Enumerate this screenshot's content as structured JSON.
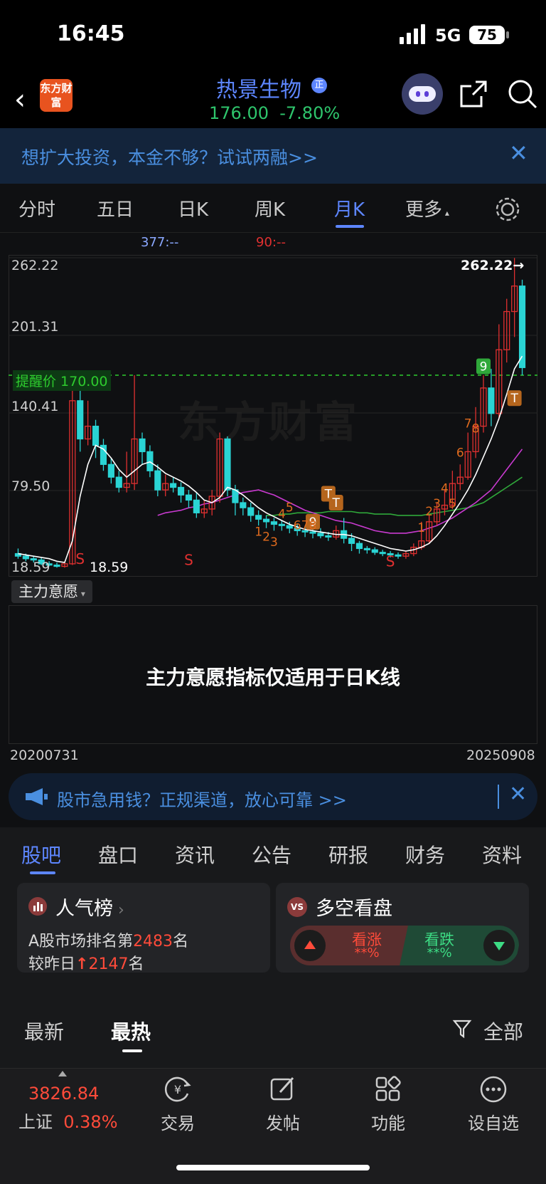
{
  "status_bar": {
    "time": "16:45",
    "network": "5G",
    "battery": "75"
  },
  "header": {
    "logo_text": "东方财富",
    "stock_name": "热景生物",
    "badge": "正",
    "price": "176.00",
    "change": "-7.80%"
  },
  "banner": {
    "text": "想扩大投资，本金不够？试试两融>>"
  },
  "period_tabs": [
    "分时",
    "五日",
    "日K",
    "周K",
    "月K",
    "更多"
  ],
  "ma_labels": {
    "ma377": "377:--",
    "ma90": "90:--"
  },
  "chart": {
    "y_labels": [
      "262.22",
      "201.31",
      "140.41",
      "79.50",
      "18.59"
    ],
    "high_label": "262.22→",
    "low_label": "18.59",
    "alert_label": "提醒价 170.00",
    "watermark": "东方财富",
    "signals": [
      "T",
      "T",
      "9",
      "T",
      "S",
      "S",
      "S"
    ],
    "seq_early": [
      "1",
      "2",
      "3",
      "4",
      "5",
      "6",
      "7",
      "8",
      "9"
    ],
    "seq_late": [
      "1",
      "2",
      "3",
      "4",
      "5",
      "6",
      "7",
      "8",
      "9"
    ],
    "colors": {
      "up": "#e03030",
      "down": "#2ad4d4",
      "ma_white": "#ffffff",
      "ma_magenta": "#c93ad0",
      "ma_green": "#2fa83a",
      "alert": "#2ecc2e"
    }
  },
  "chart_data": {
    "type": "candlestick",
    "title": "热景生物 月K",
    "y_range": [
      18.59,
      262.22
    ],
    "x_range": [
      "20200731",
      "20250908"
    ],
    "candles": [
      [
        30,
        28,
        34,
        26
      ],
      [
        28,
        26,
        30,
        24
      ],
      [
        26,
        25,
        28,
        23
      ],
      [
        25,
        22,
        27,
        21
      ],
      [
        22,
        21,
        24,
        20
      ],
      [
        21,
        20,
        23,
        19
      ],
      [
        20,
        22,
        24,
        19
      ],
      [
        22,
        150,
        170,
        21
      ],
      [
        150,
        120,
        168,
        110
      ],
      [
        120,
        130,
        150,
        115
      ],
      [
        130,
        115,
        135,
        105
      ],
      [
        115,
        100,
        120,
        95
      ],
      [
        100,
        90,
        105,
        85
      ],
      [
        90,
        82,
        95,
        78
      ],
      [
        82,
        85,
        110,
        78
      ],
      [
        85,
        120,
        170,
        80
      ],
      [
        120,
        110,
        125,
        100
      ],
      [
        110,
        95,
        115,
        90
      ],
      [
        95,
        80,
        100,
        75
      ],
      [
        80,
        85,
        92,
        75
      ],
      [
        85,
        82,
        90,
        78
      ],
      [
        82,
        76,
        86,
        70
      ],
      [
        76,
        72,
        80,
        66
      ],
      [
        72,
        62,
        78,
        58
      ],
      [
        62,
        65,
        72,
        58
      ],
      [
        65,
        75,
        80,
        60
      ],
      [
        75,
        120,
        125,
        70
      ],
      [
        120,
        80,
        122,
        75
      ],
      [
        80,
        70,
        84,
        60
      ],
      [
        70,
        66,
        74,
        60
      ],
      [
        66,
        60,
        70,
        55
      ],
      [
        60,
        57,
        64,
        52
      ],
      [
        57,
        55,
        60,
        50
      ],
      [
        55,
        53,
        58,
        48
      ],
      [
        53,
        52,
        56,
        48
      ],
      [
        52,
        50,
        55,
        46
      ],
      [
        50,
        48,
        53,
        44
      ],
      [
        48,
        47,
        52,
        43
      ],
      [
        47,
        46,
        50,
        42
      ],
      [
        46,
        44,
        50,
        42
      ],
      [
        44,
        43,
        47,
        40
      ],
      [
        43,
        48,
        52,
        41
      ],
      [
        48,
        42,
        58,
        38
      ],
      [
        42,
        38,
        46,
        32
      ],
      [
        38,
        34,
        40,
        30
      ],
      [
        34,
        33,
        36,
        30
      ],
      [
        33,
        31,
        35,
        29
      ],
      [
        31,
        30,
        33,
        28
      ],
      [
        30,
        29,
        32,
        27
      ],
      [
        29,
        28,
        31,
        26
      ],
      [
        28,
        30,
        32,
        26
      ],
      [
        30,
        35,
        38,
        28
      ],
      [
        35,
        40,
        55,
        33
      ],
      [
        40,
        55,
        60,
        38
      ],
      [
        55,
        65,
        70,
        52
      ],
      [
        65,
        68,
        80,
        60
      ],
      [
        68,
        85,
        95,
        65
      ],
      [
        85,
        90,
        100,
        80
      ],
      [
        90,
        110,
        125,
        88
      ],
      [
        110,
        130,
        145,
        105
      ],
      [
        130,
        160,
        170,
        125
      ],
      [
        160,
        140,
        175,
        130
      ],
      [
        140,
        190,
        210,
        135
      ],
      [
        190,
        220,
        230,
        180
      ],
      [
        220,
        240,
        262,
        200
      ],
      [
        240,
        176,
        245,
        170
      ]
    ],
    "ma_white": [
      30,
      29,
      28,
      27,
      26,
      24,
      23,
      40,
      75,
      100,
      115,
      112,
      105,
      96,
      90,
      95,
      100,
      102,
      98,
      93,
      90,
      87,
      83,
      78,
      72,
      70,
      74,
      82,
      80,
      76,
      71,
      66,
      62,
      59,
      56,
      53,
      51,
      49,
      48,
      47,
      46,
      45,
      45,
      44,
      42,
      40,
      38,
      36,
      34,
      33,
      32,
      33,
      35,
      38,
      44,
      52,
      61,
      70,
      80,
      92,
      106,
      120,
      136,
      155,
      175,
      185
    ],
    "ma_magenta": [
      null,
      null,
      null,
      null,
      null,
      null,
      null,
      null,
      null,
      null,
      null,
      null,
      null,
      null,
      null,
      null,
      null,
      null,
      60,
      62,
      63,
      64,
      66,
      67,
      69,
      70,
      72,
      74,
      76,
      78,
      79,
      80,
      78,
      76,
      73,
      70,
      67,
      64,
      62,
      60,
      58,
      56,
      55,
      54,
      52,
      50,
      48,
      47,
      46,
      46,
      46,
      47,
      48,
      50,
      52,
      55,
      58,
      62,
      66,
      70,
      75,
      80,
      88,
      96,
      104,
      112
    ],
    "ma_green": [
      null,
      null,
      null,
      null,
      null,
      null,
      null,
      null,
      null,
      null,
      null,
      null,
      null,
      null,
      null,
      null,
      null,
      null,
      null,
      null,
      null,
      null,
      null,
      null,
      null,
      null,
      null,
      null,
      null,
      null,
      null,
      null,
      60,
      60,
      61,
      61,
      62,
      62,
      62,
      62,
      63,
      63,
      63,
      63,
      62,
      62,
      61,
      61,
      61,
      60,
      60,
      60,
      60,
      61,
      62,
      63,
      64,
      65,
      66,
      68,
      70,
      74,
      78,
      82,
      86,
      90
    ],
    "alert_price": 170.0
  },
  "indicator": {
    "tag": "主力意愿",
    "message": "主力意愿指标仅适用于日K线",
    "start_date": "20200731",
    "end_date": "20250908"
  },
  "ad": {
    "text": "股市急用钱？正规渠道，放心可靠 >>"
  },
  "bottom_tabs": [
    "股吧",
    "盘口",
    "资讯",
    "公告",
    "研报",
    "财务",
    "资料"
  ],
  "popularity_card": {
    "title": "人气榜",
    "line1_prefix": "A股市场排名第",
    "rank": "2483",
    "line1_suffix": "名",
    "line2_prefix": "较昨日",
    "delta": "2147",
    "line2_suffix": "名"
  },
  "bull_bear_card": {
    "title": "多空看盘",
    "up_label": "看涨",
    "up_value": "**%",
    "down_label": "看跌",
    "down_value": "**%"
  },
  "sort_tabs": {
    "latest": "最新",
    "hot": "最热",
    "filter": "全部"
  },
  "nav": {
    "index_value": "3826.84",
    "index_name": "上证",
    "index_change": "0.38%",
    "items": [
      "交易",
      "发帖",
      "功能",
      "设自选"
    ]
  }
}
